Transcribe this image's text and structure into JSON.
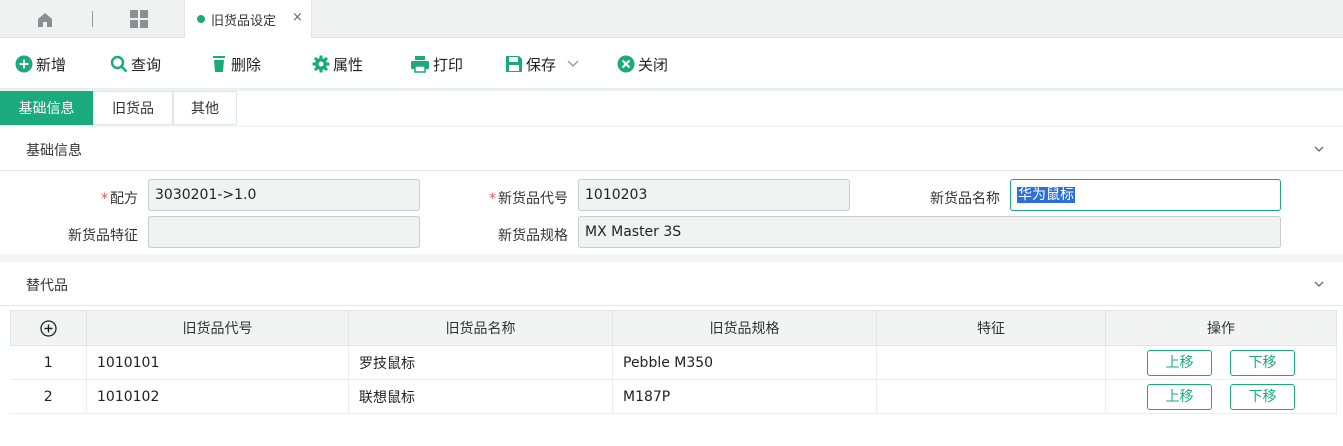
{
  "tabbar": {
    "page_tab_label": "旧货品设定",
    "close_glyph": "×",
    "icons": [
      "home-icon",
      "grid-icon"
    ]
  },
  "toolbar": {
    "new": "新增",
    "query": "查询",
    "delete": "删除",
    "properties": "属性",
    "print": "打印",
    "save": "保存",
    "close": "关闭"
  },
  "subtabs": [
    "基础信息",
    "旧货品",
    "其他"
  ],
  "basic_section": {
    "title": "基础信息",
    "recipe_label": "配方",
    "recipe_value": "3030201->1.0",
    "new_code_label": "新货品代号",
    "new_code_value": "1010203",
    "new_name_label": "新货品名称",
    "new_name_value": "华为鼠标",
    "new_feature_label": "新货品特征",
    "new_feature_value": "",
    "new_spec_label": "新货品规格",
    "new_spec_value": "MX Master 3S"
  },
  "replacement_section": {
    "title": "替代品",
    "columns": [
      "旧货品代号",
      "旧货品名称",
      "旧货品规格",
      "特征",
      "操作"
    ],
    "rows": [
      {
        "index": "1",
        "code": "1010101",
        "name": "罗技鼠标",
        "spec": "Pebble M350",
        "feature": ""
      },
      {
        "index": "2",
        "code": "1010102",
        "name": "联想鼠标",
        "spec": "M187P",
        "feature": ""
      }
    ],
    "move_up": "上移",
    "move_down": "下移"
  },
  "colors": {
    "accent": "#1aaa7c",
    "required": "#e35b5b",
    "selection": "#2d6fd9"
  }
}
